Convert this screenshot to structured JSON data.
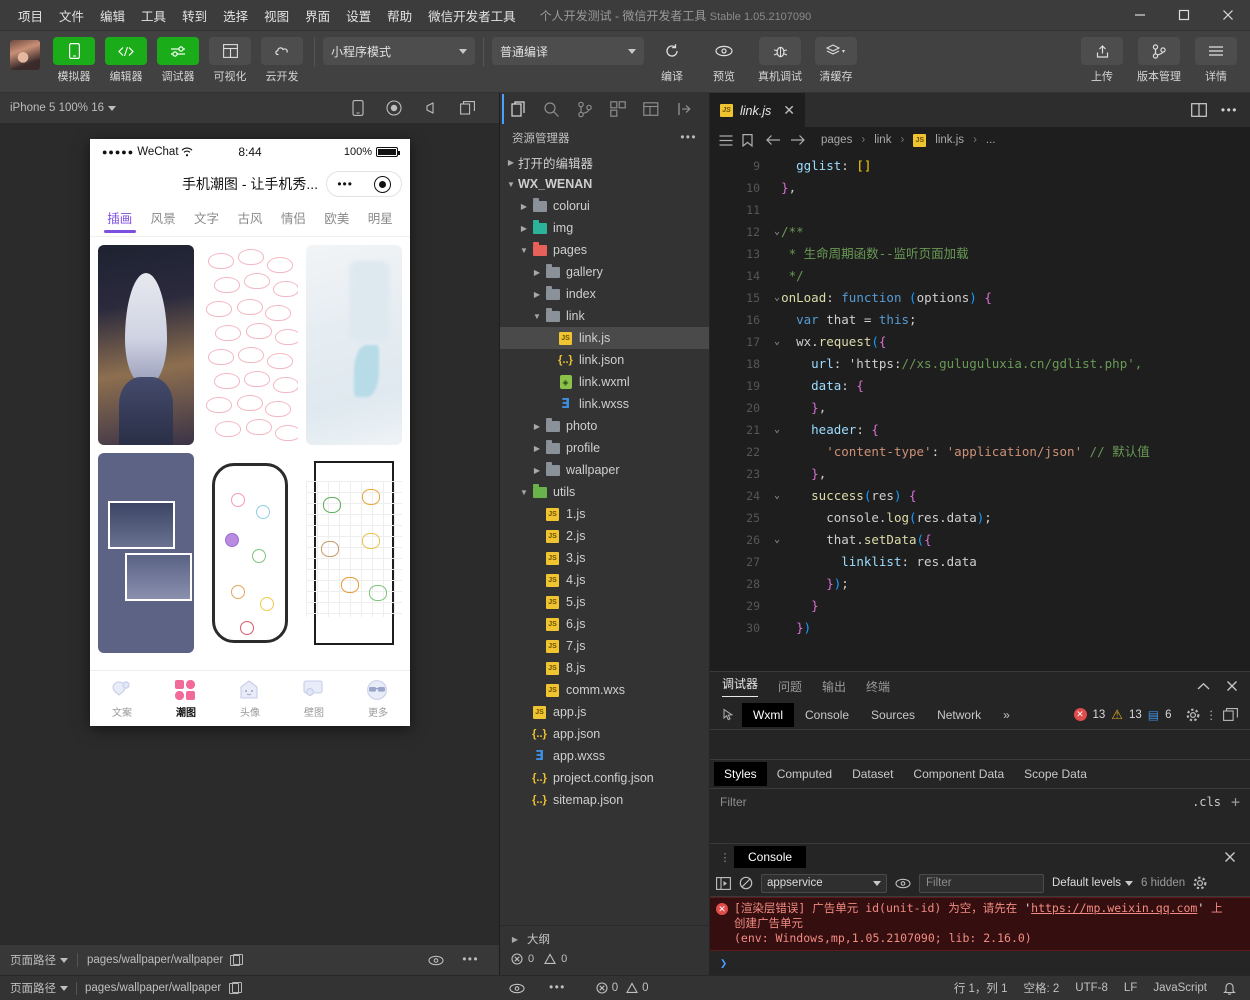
{
  "window": {
    "menus": [
      "项目",
      "文件",
      "编辑",
      "工具",
      "转到",
      "选择",
      "视图",
      "界面",
      "设置",
      "帮助",
      "微信开发者工具"
    ],
    "project_title": "个人开发测试",
    "app_name": "微信开发者工具",
    "version": "Stable 1.05.2107090",
    "minimize": "—",
    "maximize": "□",
    "close": "✕"
  },
  "toolbar": {
    "buttons": [
      {
        "label": "模拟器",
        "icon": "phone-icon",
        "accent": true
      },
      {
        "label": "编辑器",
        "icon": "code-icon",
        "accent": true
      },
      {
        "label": "调试器",
        "icon": "debug-icon",
        "accent": true
      },
      {
        "label": "可视化",
        "icon": "layout-icon",
        "accent": false
      },
      {
        "label": "云开发",
        "icon": "cloud-icon",
        "accent": false
      }
    ],
    "mode_select": "小程序模式",
    "compile_select": "普通编译",
    "actions": [
      {
        "label": "编译",
        "icon": "refresh-icon"
      },
      {
        "label": "预览",
        "icon": "eye-icon"
      },
      {
        "label": "真机调试",
        "icon": "bug-icon"
      },
      {
        "label": "清缓存",
        "icon": "layers-icon"
      }
    ],
    "right_actions": [
      {
        "label": "上传",
        "icon": "upload-icon"
      },
      {
        "label": "版本管理",
        "icon": "branch-icon"
      },
      {
        "label": "详情",
        "icon": "menu-icon"
      }
    ]
  },
  "simulator": {
    "device_label": "iPhone 5 100% 16",
    "icons": [
      "phone-icon",
      "record-icon",
      "volume-icon",
      "window-icon"
    ],
    "phone": {
      "carrier": "WeChat",
      "signal_dots": "●●●●●",
      "time": "8:44",
      "battery_pct": "100%",
      "nav_title": "手机潮图 - 让手机秀...",
      "capsule_more": "•••",
      "tabs": [
        "插画",
        "风景",
        "文字",
        "古风",
        "情侣",
        "欧美",
        "明星"
      ],
      "active_tab": "插画",
      "cards": [
        {
          "name": "anime-girl-wallpaper"
        },
        {
          "name": "pink-cinnamoroll-pattern"
        },
        {
          "name": "pastel-blue-abstract"
        },
        {
          "name": "blue-photo-collage"
        },
        {
          "name": "doodle-sticker-sheet"
        },
        {
          "name": "kawaii-animal-stickers"
        }
      ],
      "tabbar": [
        {
          "label": "文案",
          "icon": "balloon-icon",
          "active": false
        },
        {
          "label": "潮图",
          "icon": "grid-icon",
          "active": true
        },
        {
          "label": "头像",
          "icon": "ghost-icon",
          "active": false
        },
        {
          "label": "壁图",
          "icon": "frame-icon",
          "active": false
        },
        {
          "label": "更多",
          "icon": "sunglasses-icon",
          "active": false
        }
      ]
    },
    "footer": {
      "page_path_label": "页面路径",
      "page_path": "pages/wallpaper/wallpaper",
      "copy_icon": "copy-icon",
      "eye_icon": "eye-icon",
      "more_icon": "more-icon"
    }
  },
  "explorer": {
    "activity_icons": [
      "files-icon",
      "search-icon",
      "source-control-icon",
      "extensions-icon",
      "debug-panel-icon",
      "collapse-icon"
    ],
    "title": "资源管理器",
    "more": "•••",
    "sections": [
      {
        "label": "打开的编辑器",
        "expanded": false,
        "depth": 0,
        "kind": "section"
      },
      {
        "label": "WX_WENAN",
        "expanded": true,
        "depth": 0,
        "kind": "root"
      }
    ],
    "tree": [
      {
        "label": "colorui",
        "kind": "folder",
        "depth": 1,
        "expanded": false,
        "color": "grey"
      },
      {
        "label": "img",
        "kind": "folder",
        "depth": 1,
        "expanded": false,
        "color": "teal"
      },
      {
        "label": "pages",
        "kind": "folder",
        "depth": 1,
        "expanded": true,
        "color": "red"
      },
      {
        "label": "gallery",
        "kind": "folder",
        "depth": 2,
        "expanded": false,
        "color": "grey"
      },
      {
        "label": "index",
        "kind": "folder",
        "depth": 2,
        "expanded": false,
        "color": "grey"
      },
      {
        "label": "link",
        "kind": "folder",
        "depth": 2,
        "expanded": true,
        "color": "grey"
      },
      {
        "label": "link.js",
        "kind": "js",
        "depth": 3,
        "selected": true
      },
      {
        "label": "link.json",
        "kind": "json",
        "depth": 3
      },
      {
        "label": "link.wxml",
        "kind": "wxml",
        "depth": 3
      },
      {
        "label": "link.wxss",
        "kind": "wxss",
        "depth": 3
      },
      {
        "label": "photo",
        "kind": "folder",
        "depth": 2,
        "expanded": false,
        "color": "grey"
      },
      {
        "label": "profile",
        "kind": "folder",
        "depth": 2,
        "expanded": false,
        "color": "grey"
      },
      {
        "label": "wallpaper",
        "kind": "folder",
        "depth": 2,
        "expanded": false,
        "color": "grey"
      },
      {
        "label": "utils",
        "kind": "folder",
        "depth": 1,
        "expanded": true,
        "color": "green"
      },
      {
        "label": "1.js",
        "kind": "js",
        "depth": 2
      },
      {
        "label": "2.js",
        "kind": "js",
        "depth": 2
      },
      {
        "label": "3.js",
        "kind": "js",
        "depth": 2
      },
      {
        "label": "4.js",
        "kind": "js",
        "depth": 2
      },
      {
        "label": "5.js",
        "kind": "js",
        "depth": 2
      },
      {
        "label": "6.js",
        "kind": "js",
        "depth": 2
      },
      {
        "label": "7.js",
        "kind": "js",
        "depth": 2
      },
      {
        "label": "8.js",
        "kind": "js",
        "depth": 2
      },
      {
        "label": "comm.wxs",
        "kind": "js",
        "depth": 2
      },
      {
        "label": "app.js",
        "kind": "js",
        "depth": 1
      },
      {
        "label": "app.json",
        "kind": "json",
        "depth": 1
      },
      {
        "label": "app.wxss",
        "kind": "wxss",
        "depth": 1
      },
      {
        "label": "project.config.json",
        "kind": "json",
        "depth": 1
      },
      {
        "label": "sitemap.json",
        "kind": "json",
        "depth": 1
      }
    ],
    "outline": {
      "label": "大纲",
      "error_count": "0",
      "warning_count": "0"
    }
  },
  "editor": {
    "tab": {
      "name": "link.js",
      "icon": "js-icon",
      "close": "✕"
    },
    "split_icon": "split-editor-icon",
    "more_icon": "more-icon",
    "breadcrumb": [
      "pages",
      "link",
      "link.js",
      "..."
    ],
    "first_line_no": 9,
    "lines": [
      {
        "n": 9,
        "fold": false,
        "text": "    gglist: []"
      },
      {
        "n": 10,
        "fold": false,
        "text": "  },"
      },
      {
        "n": 11,
        "fold": false,
        "text": ""
      },
      {
        "n": 12,
        "fold": true,
        "text": "  /**"
      },
      {
        "n": 13,
        "fold": false,
        "text": "   * 生命周期函数--监听页面加载"
      },
      {
        "n": 14,
        "fold": false,
        "text": "   */"
      },
      {
        "n": 15,
        "fold": true,
        "text": "  onLoad: function (options) {"
      },
      {
        "n": 16,
        "fold": false,
        "text": "    var that = this;"
      },
      {
        "n": 17,
        "fold": true,
        "text": "    wx.request({"
      },
      {
        "n": 18,
        "fold": false,
        "text": "      url: 'https://xs.guluguluxia.cn/gdlist.php',"
      },
      {
        "n": 19,
        "fold": false,
        "text": "      data: {"
      },
      {
        "n": 20,
        "fold": false,
        "text": "      },"
      },
      {
        "n": 21,
        "fold": true,
        "text": "      header: {"
      },
      {
        "n": 22,
        "fold": false,
        "text": "        'content-type': 'application/json' // 默认值"
      },
      {
        "n": 23,
        "fold": false,
        "text": "      },"
      },
      {
        "n": 24,
        "fold": true,
        "text": "      success(res) {"
      },
      {
        "n": 25,
        "fold": false,
        "text": "        console.log(res.data);"
      },
      {
        "n": 26,
        "fold": true,
        "text": "        that.setData({"
      },
      {
        "n": 27,
        "fold": false,
        "text": "          linklist: res.data"
      },
      {
        "n": 28,
        "fold": false,
        "text": "        });"
      },
      {
        "n": 29,
        "fold": false,
        "text": "      }"
      },
      {
        "n": 30,
        "fold": false,
        "text": "    })"
      }
    ]
  },
  "debugger": {
    "panel_tabs": [
      "调试器",
      "问题",
      "输出",
      "终端"
    ],
    "panel_active": "调试器",
    "collapse_icon": "chevron-up-icon",
    "close_icon": "close-icon",
    "devtool_tabs": [
      "Wxml",
      "Console",
      "Sources",
      "Network"
    ],
    "devtool_active": "Wxml",
    "overflow": "»",
    "inspect_icon": "inspect-icon",
    "counts": {
      "errors": "13",
      "warnings": "13",
      "infos": "6"
    },
    "settings_icon": "gear-icon",
    "kebab_icon": "kebab-icon",
    "dock_icon": "dock-icon",
    "style_tabs": [
      "Styles",
      "Computed",
      "Dataset",
      "Component Data",
      "Scope Data"
    ],
    "style_active": "Styles",
    "filter_placeholder": "Filter",
    "cls_label": ".cls",
    "add_label": "+"
  },
  "console": {
    "title": "Console",
    "grip_icon": "grip-icon",
    "close_icon": "close-icon",
    "sidebar_icon": "console-sidebar-icon",
    "clear_icon": "clear-icon",
    "context": "appservice",
    "eye_icon": "eye-icon",
    "filter_placeholder": "Filter",
    "levels": "Default levels",
    "hidden": "6 hidden",
    "settings_icon": "gear-icon",
    "error": {
      "line1_pre": "[渲染层错误] 广告单元 id(unit-id) 为空，请先在 ",
      "link": "https://mp.weixin.qq.com",
      "line1_post": " 上",
      "line2": "创建广告单元",
      "line3": "(env: Windows,mp,1.05.2107090; lib: 2.16.0)"
    },
    "prompt": "❯"
  },
  "status_bar": {
    "cursor": "行 1，列 1",
    "spaces": "空格: 2",
    "encoding": "UTF-8",
    "eol": "LF",
    "language": "JavaScript",
    "bell_icon": "bell-icon"
  }
}
